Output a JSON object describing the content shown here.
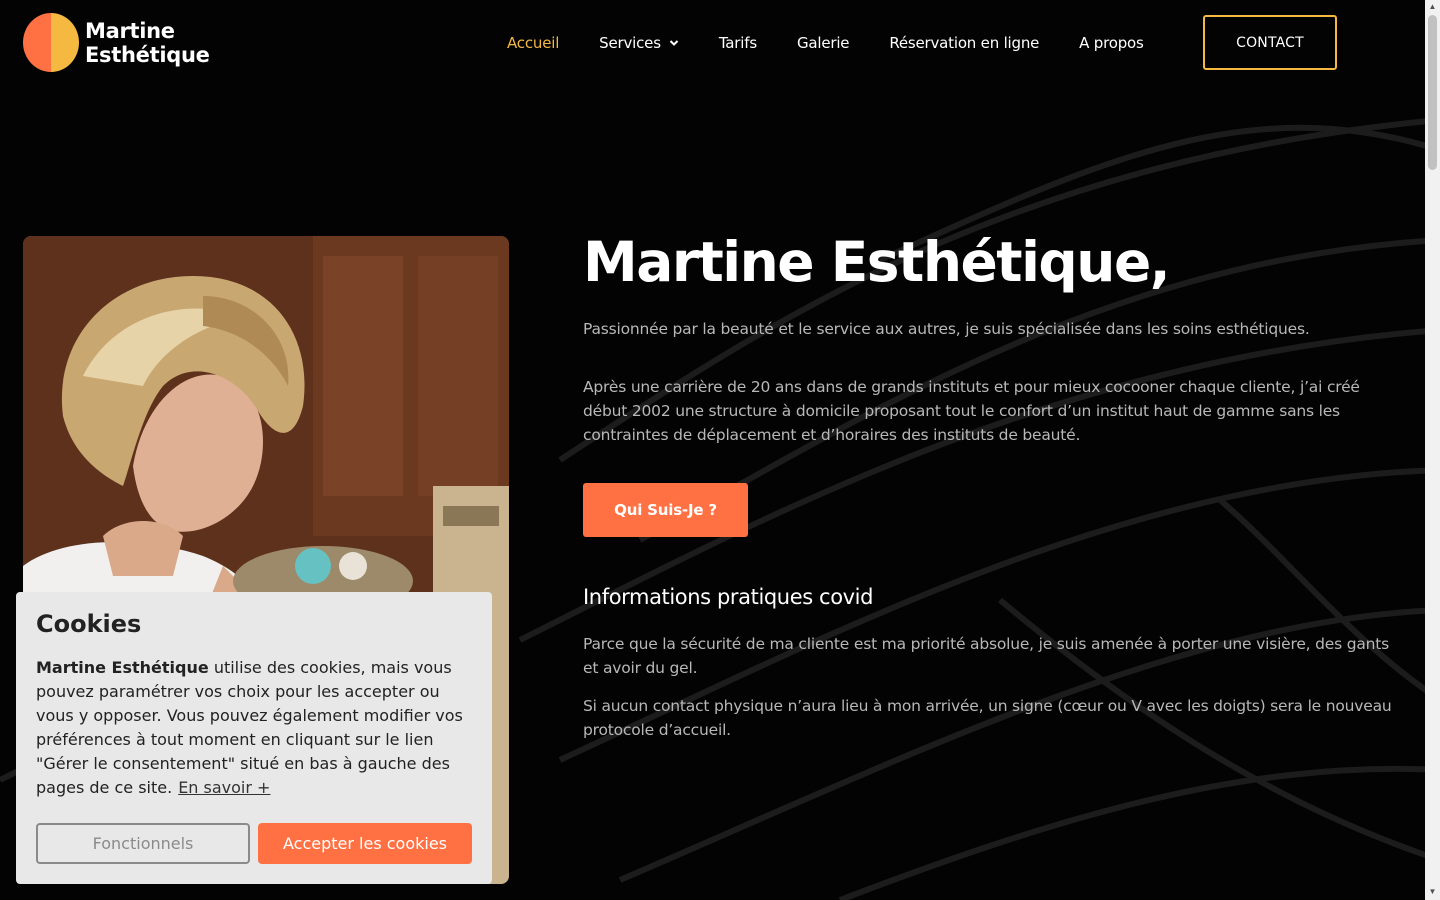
{
  "brand": {
    "name_line1": "Martine",
    "name_line2": "Esthétique",
    "colors": {
      "orange": "#ff7043",
      "yellow": "#f5b841"
    }
  },
  "nav": {
    "items": [
      {
        "label": "Accueil",
        "active": true
      },
      {
        "label": "Services",
        "has_dropdown": true
      },
      {
        "label": "Tarifs"
      },
      {
        "label": "Galerie"
      },
      {
        "label": "Réservation en ligne"
      },
      {
        "label": "A propos"
      }
    ],
    "contact_label": "CONTACT"
  },
  "hero": {
    "title": "Martine Esthétique,",
    "intro": "Passionnée par la beauté et le service aux autres, je suis spécialisée dans les soins esthétiques.",
    "body": "Après une carrière de 20 ans dans de grands instituts et pour mieux cocooner chaque cliente, j’ai créé début 2002 une structure à domicile proposant tout le confort d’un institut haut de gamme sans les contraintes de déplacement et d’horaires des instituts de beauté.",
    "cta_label": "Qui Suis-Je ?",
    "covid_title": "Informations pratiques covid",
    "covid_p1": "Parce que la sécurité de ma cliente est ma priorité absolue, je suis amenée à porter une visière, des gants et avoir du gel.",
    "covid_p2": "Si aucun contact physique n’aura lieu à mon arrivée, un signe (cœur ou V avec les doigts) sera le nouveau protocole d’accueil."
  },
  "cookie": {
    "title": "Cookies",
    "brand": "Martine Esthétique",
    "text": " utilise des cookies, mais vous pouvez paramétrer vos choix pour les accepter ou vous y opposer. Vous pouvez également modifier vos préférences à tout moment en cliquant sur le lien \"Gérer le consentement\" situé en bas à gauche des pages de ce site.",
    "link_label": "En savoir +",
    "functional_label": "Fonctionnels",
    "accept_label": "Accepter les cookies"
  }
}
